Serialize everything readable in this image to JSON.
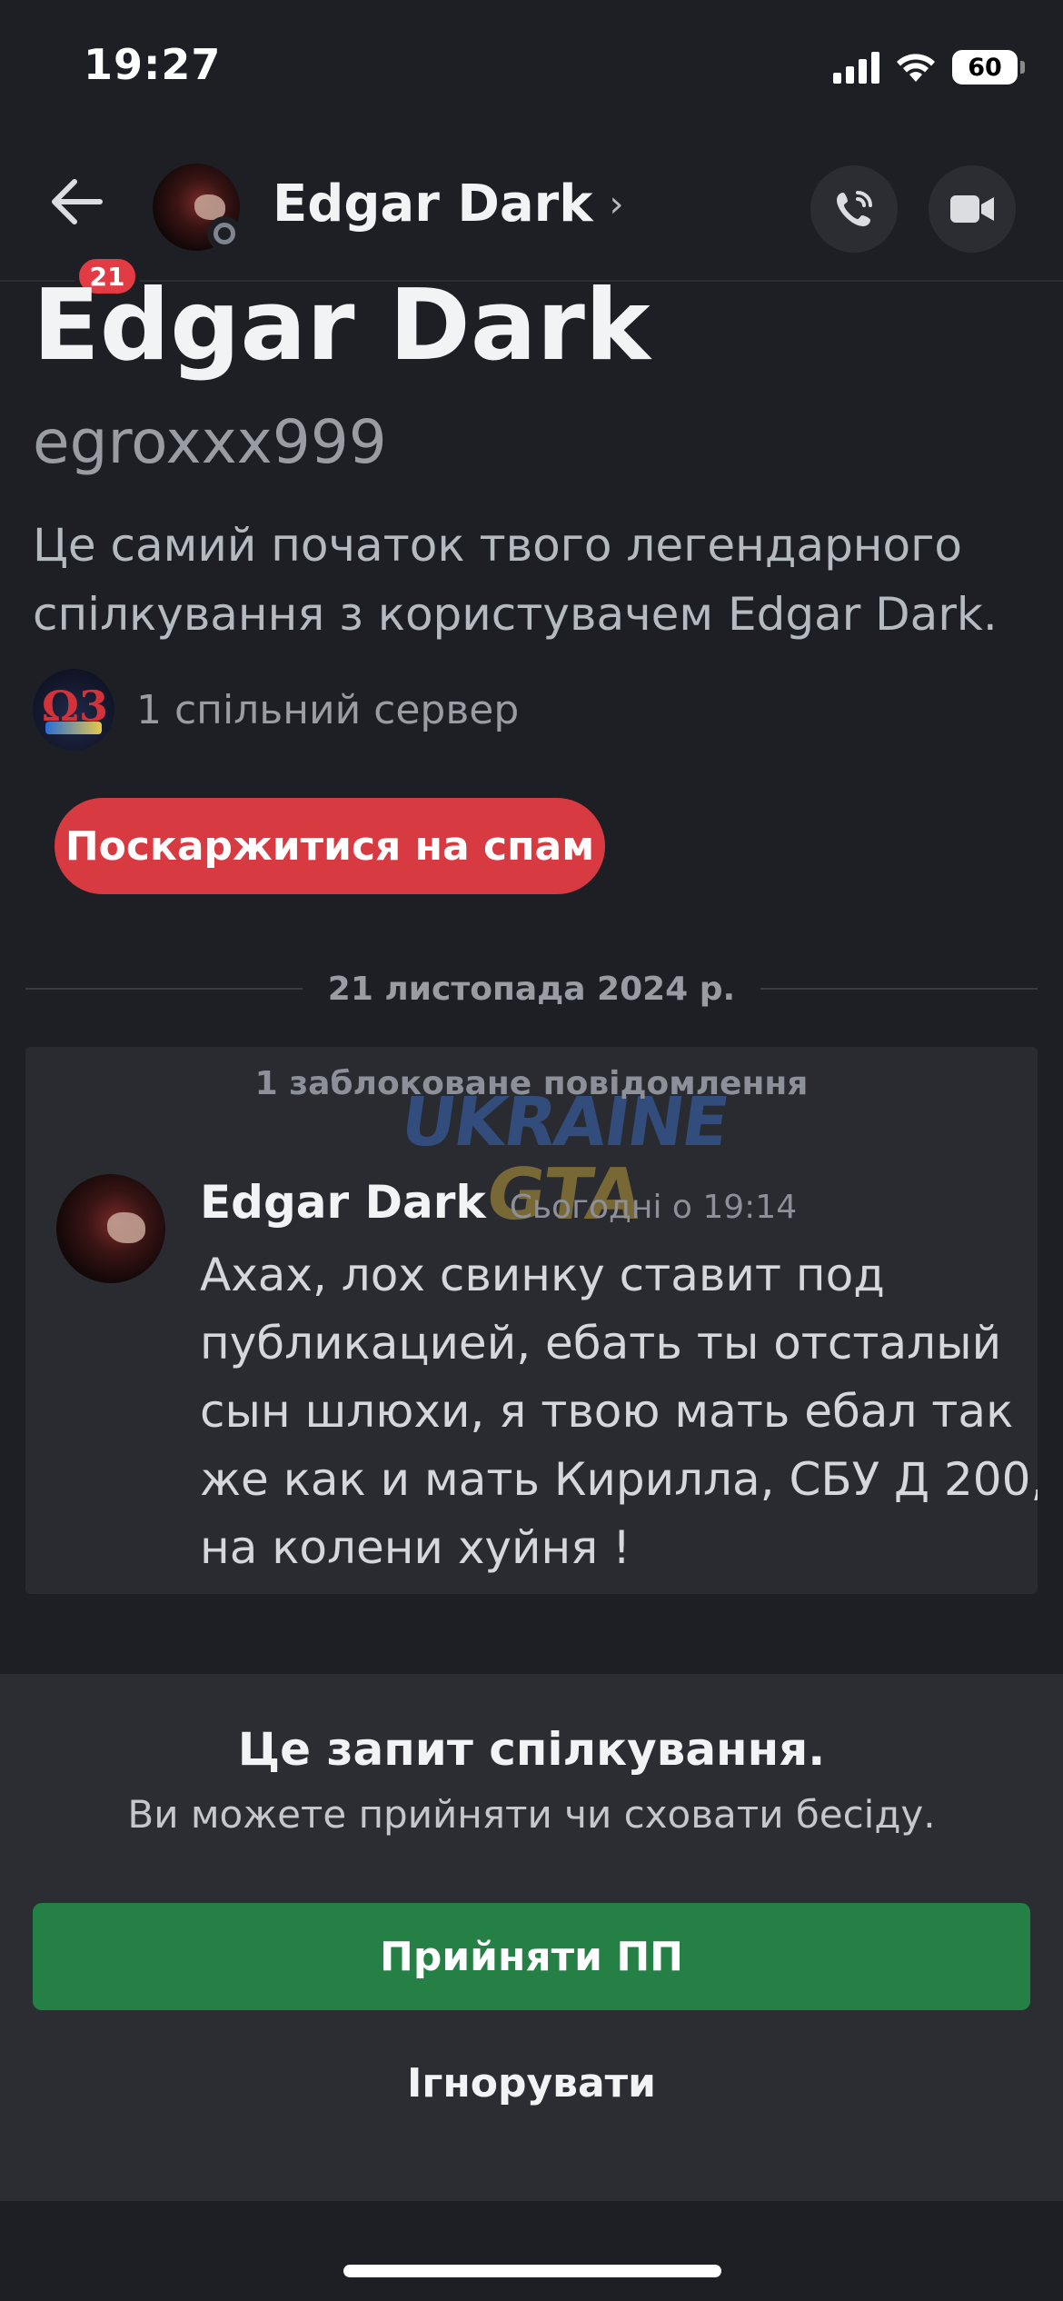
{
  "status_bar": {
    "time": "19:27",
    "battery": "60",
    "icons": [
      "cellular-signal-icon",
      "wifi-icon",
      "battery-icon"
    ]
  },
  "header": {
    "back_icon": "arrow-left-icon",
    "unread_badge": "21",
    "title": "Edgar Dark",
    "chevron": "›",
    "presence": "offline",
    "actions": [
      "phone-call-icon",
      "video-camera-icon"
    ]
  },
  "intro": {
    "display_name": "Edgar Dark",
    "username": "egroxxx999",
    "description": "Це самий початок твого легендарного спілкування з користувачем Edgar Dark.",
    "mutual_servers": "1 спільний сервер",
    "spam_button": "Поскаржитися на спам"
  },
  "date_divider": "21 листопада 2024 р.",
  "blocked": {
    "header": "1 заблоковане повідомлення",
    "watermark_line1": "UKRAINE",
    "watermark_line2": "GTA",
    "message": {
      "author": "Edgar Dark",
      "timestamp": "Сьогодні о 19:14",
      "text": "Ахах, лох свинку ставит под публикацией, ебать ты отсталый сын шлюхи, я твою мать ебал так же как и мать Кирилла, СБУ Д 200, на колени хуйня !"
    }
  },
  "request": {
    "title": "Це запит спілкування.",
    "subtitle": "Ви можете прийняти чи сховати бесіду.",
    "accept_label": "Прийняти ПП",
    "ignore_label": "Ігнорувати"
  },
  "colors": {
    "background": "#1e1f24",
    "panel": "#2b2d33",
    "danger": "#d83a42",
    "success": "#248045",
    "muted_text": "#9a9ca3"
  }
}
